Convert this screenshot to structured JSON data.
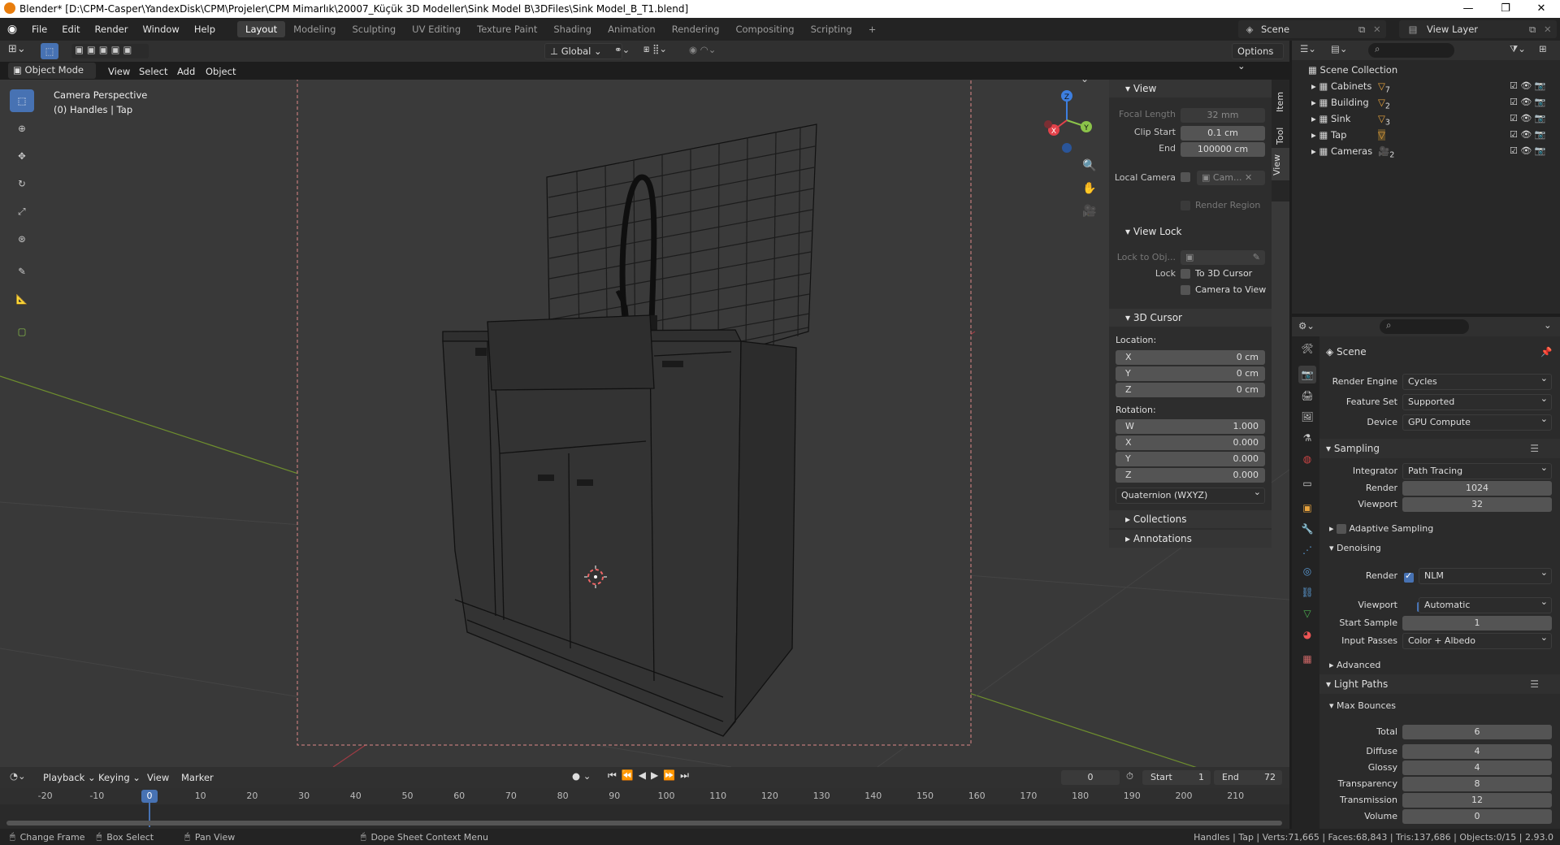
{
  "window": {
    "title": "Blender* [D:\\CPM-Casper\\YandexDisk\\CPM\\Projeler\\CPM Mimarlık\\20007_Küçük 3D Modeller\\Sink Model B\\3DFiles\\Sink Model_B_T1.blend]",
    "minimize": "—",
    "maximize": "❐",
    "close": "✕"
  },
  "menus": [
    "File",
    "Edit",
    "Render",
    "Window",
    "Help"
  ],
  "workspaces": [
    "Layout",
    "Modeling",
    "Sculpting",
    "UV Editing",
    "Texture Paint",
    "Shading",
    "Animation",
    "Rendering",
    "Compositing",
    "Scripting"
  ],
  "workspace_add": "+",
  "scene_name": "Scene",
  "view_layer_name": "View Layer",
  "viewport_header": {
    "mode": "Object Mode",
    "menus": [
      "View",
      "Select",
      "Add",
      "Object"
    ],
    "transform_orientation": "Global",
    "options": "Options"
  },
  "viewport": {
    "overlay_line1": "Camera Perspective",
    "overlay_line2": "(0) Handles | Tap",
    "gizmo": {
      "x": "X",
      "y": "Y",
      "z": "Z"
    }
  },
  "npanel": {
    "tabs": [
      "Item",
      "Tool",
      "View"
    ],
    "view_header": "View",
    "focal_length_label": "Focal Length",
    "focal_length": "32 mm",
    "clip_start_label": "Clip Start",
    "clip_start": "0.1 cm",
    "end_label": "End",
    "end": "100000 cm",
    "local_camera_label": "Local Camera",
    "local_camera_value": "Cam...",
    "render_region": "Render Region",
    "view_lock_header": "View Lock",
    "lock_to_obj_label": "Lock to Obj...",
    "lock_label": "Lock",
    "to_3d_cursor": "To 3D Cursor",
    "camera_to_view": "Camera to View",
    "cursor_header": "3D Cursor",
    "location_label": "Location:",
    "loc_x_label": "X",
    "loc_x": "0 cm",
    "loc_y_label": "Y",
    "loc_y": "0 cm",
    "loc_z_label": "Z",
    "loc_z": "0 cm",
    "rotation_label": "Rotation:",
    "rot_w_label": "W",
    "rot_w": "1.000",
    "rot_x_label": "X",
    "rot_x": "0.000",
    "rot_y_label": "Y",
    "rot_y": "0.000",
    "rot_z_label": "Z",
    "rot_z": "0.000",
    "rotation_mode": "Quaternion (WXYZ)",
    "collections_header": "Collections",
    "annotations_header": "Annotations"
  },
  "outliner": {
    "root": "Scene Collection",
    "items": [
      {
        "name": "Cabinets",
        "badge": "7"
      },
      {
        "name": "Building",
        "badge": "2"
      },
      {
        "name": "Sink",
        "badge": "3"
      },
      {
        "name": "Tap",
        "badge": ""
      },
      {
        "name": "Cameras",
        "badge": "2"
      }
    ]
  },
  "properties": {
    "title": "Scene",
    "render_engine_label": "Render Engine",
    "render_engine": "Cycles",
    "feature_set_label": "Feature Set",
    "feature_set": "Supported",
    "device_label": "Device",
    "device": "GPU Compute",
    "sampling_header": "Sampling",
    "integrator_label": "Integrator",
    "integrator": "Path Tracing",
    "render_label": "Render",
    "render_samples": "1024",
    "viewport_label": "Viewport",
    "viewport_samples": "32",
    "adaptive_sampling": "Adaptive Sampling",
    "denoising_header": "Denoising",
    "denoise_render_label": "Render",
    "denoise_render": "NLM",
    "denoise_viewport_label": "Viewport",
    "denoise_viewport": "Automatic",
    "start_sample_label": "Start Sample",
    "start_sample": "1",
    "input_passes_label": "Input Passes",
    "input_passes": "Color + Albedo",
    "advanced_header": "Advanced",
    "light_paths_header": "Light Paths",
    "max_bounces_header": "Max Bounces",
    "bounces": [
      {
        "label": "Total",
        "value": "6"
      },
      {
        "label": "Diffuse",
        "value": "4"
      },
      {
        "label": "Glossy",
        "value": "4"
      },
      {
        "label": "Transparency",
        "value": "8"
      },
      {
        "label": "Transmission",
        "value": "12"
      },
      {
        "label": "Volume",
        "value": "0"
      }
    ]
  },
  "timeline": {
    "menus": [
      "Playback",
      "Keying",
      "View",
      "Marker"
    ],
    "current_frame": "0",
    "start_label": "Start",
    "start": "1",
    "end_label": "End",
    "end": "72",
    "ticks": [
      "-20",
      "-10",
      "0",
      "10",
      "20",
      "30",
      "40",
      "50",
      "60",
      "70",
      "80",
      "90",
      "100",
      "110",
      "120",
      "130",
      "140",
      "150",
      "160",
      "170",
      "180",
      "190",
      "200",
      "210"
    ]
  },
  "statusbar": {
    "change_frame": "Change Frame",
    "box_select": "Box Select",
    "pan_view": "Pan View",
    "context_menu": "Dope Sheet Context Menu",
    "stats": "Handles | Tap | Verts:71,665 | Faces:68,843 | Tris:137,686 | Objects:0/15 | 2.93.0"
  },
  "colors": {
    "accent": "#4772b3",
    "x_axis": "#e3424a",
    "y_axis": "#8bc34a",
    "z_axis": "#3d7fe0"
  }
}
